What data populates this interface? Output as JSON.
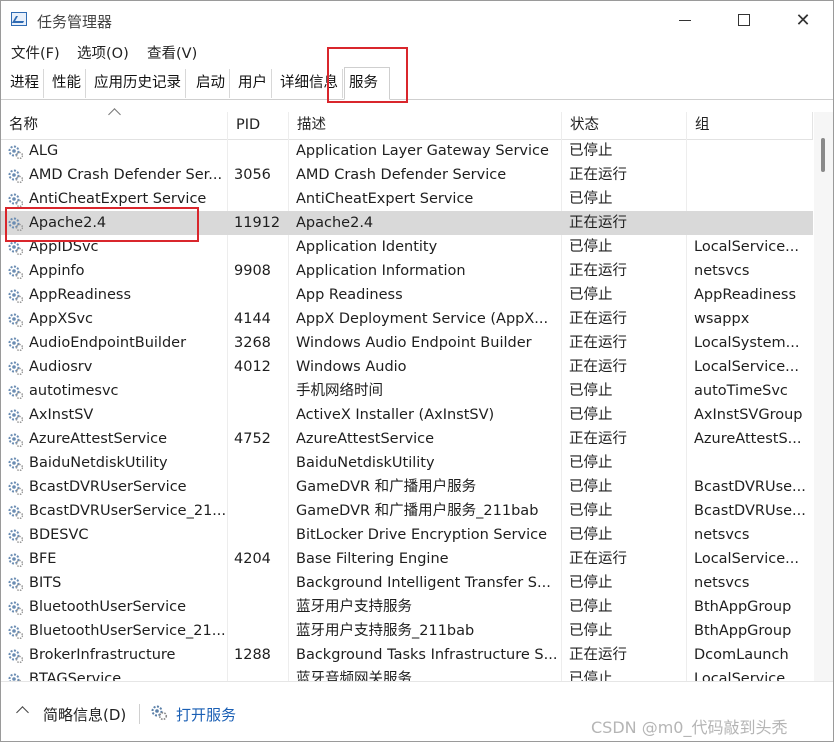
{
  "window": {
    "title": "任务管理器"
  },
  "menu": [
    "文件(F)",
    "选项(O)",
    "查看(V)"
  ],
  "tabs": [
    "进程",
    "性能",
    "应用历史记录",
    "启动",
    "用户",
    "详细信息",
    "服务"
  ],
  "active_tab": "服务",
  "columns": {
    "name": "名称",
    "pid": "PID",
    "desc": "描述",
    "status": "状态",
    "group": "组"
  },
  "rows": [
    {
      "name": "ALG",
      "pid": "",
      "desc": "Application Layer Gateway Service",
      "status": "已停止",
      "group": ""
    },
    {
      "name": "AMD Crash Defender Ser...",
      "pid": "3056",
      "desc": "AMD Crash Defender Service",
      "status": "正在运行",
      "group": ""
    },
    {
      "name": "AntiCheatExpert Service",
      "pid": "",
      "desc": "AntiCheatExpert Service",
      "status": "已停止",
      "group": ""
    },
    {
      "name": "Apache2.4",
      "pid": "11912",
      "desc": "Apache2.4",
      "status": "正在运行",
      "group": ""
    },
    {
      "name": "AppIDSvc",
      "pid": "",
      "desc": "Application Identity",
      "status": "已停止",
      "group": "LocalService..."
    },
    {
      "name": "Appinfo",
      "pid": "9908",
      "desc": "Application Information",
      "status": "正在运行",
      "group": "netsvcs"
    },
    {
      "name": "AppReadiness",
      "pid": "",
      "desc": "App Readiness",
      "status": "已停止",
      "group": "AppReadiness"
    },
    {
      "name": "AppXSvc",
      "pid": "4144",
      "desc": "AppX Deployment Service (AppX...",
      "status": "正在运行",
      "group": "wsappx"
    },
    {
      "name": "AudioEndpointBuilder",
      "pid": "3268",
      "desc": "Windows Audio Endpoint Builder",
      "status": "正在运行",
      "group": "LocalSystem..."
    },
    {
      "name": "Audiosrv",
      "pid": "4012",
      "desc": "Windows Audio",
      "status": "正在运行",
      "group": "LocalService..."
    },
    {
      "name": "autotimesvc",
      "pid": "",
      "desc": "手机网络时间",
      "status": "已停止",
      "group": "autoTimeSvc"
    },
    {
      "name": "AxInstSV",
      "pid": "",
      "desc": "ActiveX Installer (AxInstSV)",
      "status": "已停止",
      "group": "AxInstSVGroup"
    },
    {
      "name": "AzureAttestService",
      "pid": "4752",
      "desc": "AzureAttestService",
      "status": "正在运行",
      "group": "AzureAttestS..."
    },
    {
      "name": "BaiduNetdiskUtility",
      "pid": "",
      "desc": "BaiduNetdiskUtility",
      "status": "已停止",
      "group": ""
    },
    {
      "name": "BcastDVRUserService",
      "pid": "",
      "desc": "GameDVR 和广播用户服务",
      "status": "已停止",
      "group": "BcastDVRUse..."
    },
    {
      "name": "BcastDVRUserService_21...",
      "pid": "",
      "desc": "GameDVR 和广播用户服务_211bab",
      "status": "已停止",
      "group": "BcastDVRUse..."
    },
    {
      "name": "BDESVC",
      "pid": "",
      "desc": "BitLocker Drive Encryption Service",
      "status": "已停止",
      "group": "netsvcs"
    },
    {
      "name": "BFE",
      "pid": "4204",
      "desc": "Base Filtering Engine",
      "status": "正在运行",
      "group": "LocalService..."
    },
    {
      "name": "BITS",
      "pid": "",
      "desc": "Background Intelligent Transfer S...",
      "status": "已停止",
      "group": "netsvcs"
    },
    {
      "name": "BluetoothUserService",
      "pid": "",
      "desc": "蓝牙用户支持服务",
      "status": "已停止",
      "group": "BthAppGroup"
    },
    {
      "name": "BluetoothUserService_21...",
      "pid": "",
      "desc": "蓝牙用户支持服务_211bab",
      "status": "已停止",
      "group": "BthAppGroup"
    },
    {
      "name": "BrokerInfrastructure",
      "pid": "1288",
      "desc": "Background Tasks Infrastructure S...",
      "status": "正在运行",
      "group": "DcomLaunch"
    },
    {
      "name": "BTAGService",
      "pid": "",
      "desc": "蓝牙音频网关服务",
      "status": "已停止",
      "group": "LocalService..."
    }
  ],
  "selected_row": "Apache2.4",
  "footer": {
    "brief_info": "简略信息(D)",
    "open_services": "打开服务"
  },
  "watermark": "CSDN @m0_代码敲到头秃",
  "colors": {
    "highlight_box": "#d9262c",
    "selected_row": "#d9d9d9",
    "link": "#1a5fb4"
  }
}
